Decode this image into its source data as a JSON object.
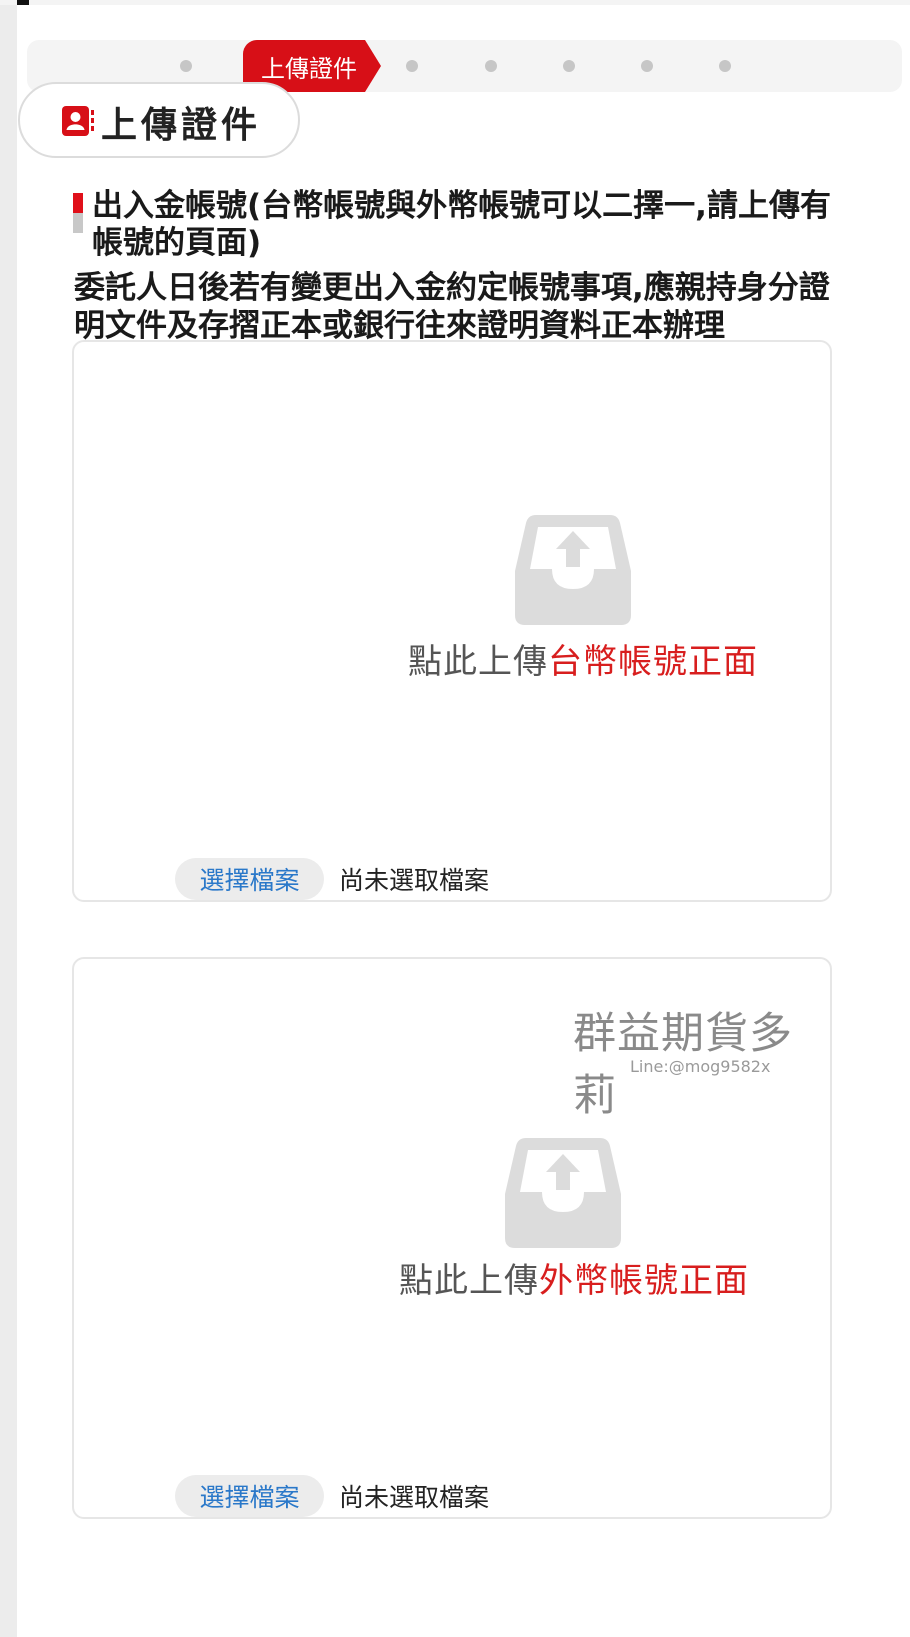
{
  "steps": {
    "active_label": "上傳證件"
  },
  "section": {
    "title": "上傳證件",
    "icon": "contact-card-icon"
  },
  "heading": "出入金帳號(台幣帳號與外幣帳號可以二擇一,請上傳有帳號的頁面)",
  "notice": "委託人日後若有變更出入金約定帳號事項,應親持身分證明文件及存摺正本或銀行往來證明資料正本辦理",
  "uploads": [
    {
      "prompt": "點此上傳",
      "target": "台幣帳號正面",
      "button": "選擇檔案",
      "status": "尚未選取檔案"
    },
    {
      "prompt": "點此上傳",
      "target": "外幣帳號正面",
      "button": "選擇檔案",
      "status": "尚未選取檔案"
    }
  ],
  "watermark": {
    "title": "群益期貨多莉",
    "line": "Line:@mog9582x"
  },
  "colors": {
    "brand_red": "#d70f17",
    "link_blue": "#2a78c9",
    "icon_gray": "#dcdcdc"
  }
}
